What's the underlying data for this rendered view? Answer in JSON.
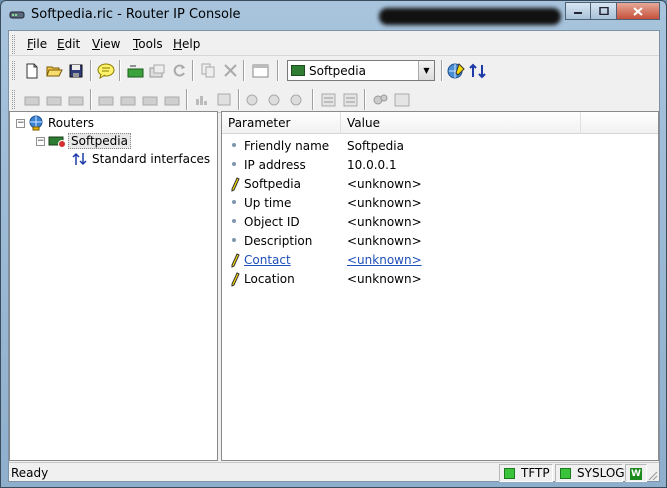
{
  "window": {
    "title": "Softpedia.ric - Router IP Console"
  },
  "menu": {
    "items": [
      {
        "label": "File",
        "accel": "F",
        "rest": "ile"
      },
      {
        "label": "Edit",
        "accel": "E",
        "rest": "dit"
      },
      {
        "label": "View",
        "accel": "V",
        "rest": "iew"
      },
      {
        "label": "Tools",
        "accel": "T",
        "rest": "ools"
      },
      {
        "label": "Help",
        "accel": "H",
        "rest": "elp"
      }
    ]
  },
  "toolbar": {
    "router_select": {
      "value": "Softpedia"
    }
  },
  "tree": {
    "root": "Routers",
    "router": "Softpedia",
    "interfaces": "Standard interfaces"
  },
  "list": {
    "columns": [
      "Parameter",
      "Value"
    ],
    "rows": [
      {
        "param": "Friendly name",
        "value": "Softpedia",
        "marker": "bullet",
        "link": false
      },
      {
        "param": "IP address",
        "value": "10.0.0.1",
        "marker": "bullet",
        "link": false
      },
      {
        "param": "Softpedia",
        "value": "<unknown>",
        "marker": "pencil",
        "link": false
      },
      {
        "param": "Up time",
        "value": "<unknown>",
        "marker": "bullet",
        "link": false
      },
      {
        "param": "Object ID",
        "value": "<unknown>",
        "marker": "bullet",
        "link": false
      },
      {
        "param": "Description",
        "value": "<unknown>",
        "marker": "bullet",
        "link": false
      },
      {
        "param": "Contact",
        "value": "<unknown>",
        "marker": "pencil",
        "link": true
      },
      {
        "param": "Location",
        "value": "<unknown>",
        "marker": "pencil",
        "link": false
      }
    ]
  },
  "status": {
    "text": "Ready",
    "tftp": "TFTP",
    "syslog": "SYSLOG",
    "badge": "W"
  },
  "colors": {
    "led_green": "#3bc43b",
    "link_blue": "#1f4fb8",
    "accent_yellow": "#f5d800"
  }
}
